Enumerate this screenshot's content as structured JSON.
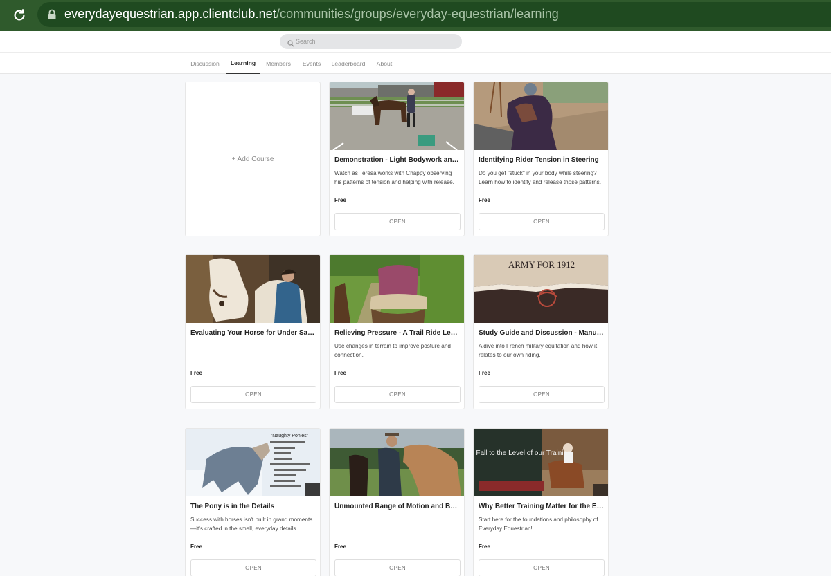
{
  "browser": {
    "url_host": "everydayequestrian.app.clientclub.net",
    "url_path": "/communities/groups/everyday-equestrian/learning"
  },
  "header": {
    "search_placeholder": "Search"
  },
  "tabs": [
    {
      "label": "Discussion"
    },
    {
      "label": "Learning",
      "active": true
    },
    {
      "label": "Members"
    },
    {
      "label": "Events"
    },
    {
      "label": "Leaderboard"
    },
    {
      "label": "About"
    }
  ],
  "add_course_label": "+ Add Course",
  "open_label": "OPEN",
  "courses": [
    {
      "title": "Demonstration - Light Bodywork and Release",
      "description": "Watch as Teresa works with Chappy observing his patterns of tension and helping with release.",
      "price": "Free"
    },
    {
      "title": "Identifying Rider Tension in Steering",
      "description": "Do you get \"stuck\" in your body while steering? Learn how to identify and release those patterns.",
      "price": "Free"
    },
    {
      "title": "Evaluating Your Horse for Under Saddle Work",
      "description": "",
      "price": "Free"
    },
    {
      "title": "Relieving Pressure - A Trail Ride Lesson",
      "description": "Use changes in terrain to improve posture and connection.",
      "price": "Free"
    },
    {
      "title": "Study Guide and Discussion - Manual of Equitation",
      "description": "A dive into French military equitation and how it relates to our own riding.",
      "price": "Free",
      "thumb_text": "ARMY FOR 1912"
    },
    {
      "title": "The Pony is in the Details",
      "description": "Success with horses isn't built in grand moments—it's crafted in the small, everyday details.",
      "price": "Free",
      "thumb_text": "\"Naughty Ponies\""
    },
    {
      "title": "Unmounted Range of Motion and Body Work",
      "description": "",
      "price": "Free"
    },
    {
      "title": "Why Better Training Matter for the Everyday Equestrian",
      "description": "Start here for the foundations and philosophy of Everyday Equestrian!",
      "price": "Free",
      "thumb_text": "We Rise or Fall to the Level of our Training"
    }
  ],
  "colors": {
    "browser_bar": "#2f5a2c",
    "url_pill": "#1f4a20",
    "page_bg": "#f7f8fa",
    "active_tab": "#222222"
  }
}
